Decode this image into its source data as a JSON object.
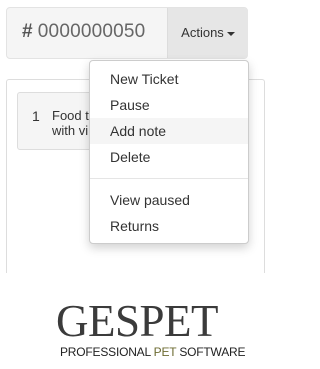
{
  "ticket": {
    "hash": "#",
    "number": "0000000050"
  },
  "actions": {
    "label": "Actions"
  },
  "menu": {
    "items": [
      {
        "label": "New Ticket"
      },
      {
        "label": "Pause"
      },
      {
        "label": "Add note"
      },
      {
        "label": "Delete"
      }
    ],
    "secondary_items": [
      {
        "label": "View paused"
      },
      {
        "label": "Returns"
      }
    ]
  },
  "list": {
    "item": {
      "number": "1",
      "line1": "Food t",
      "line2": "with vi"
    }
  },
  "logo": {
    "part1": "GES",
    "part2": "PET",
    "tag_part1": "PROFESSIONAL ",
    "tag_part2": "PET",
    "tag_part3": " SOFTWARE",
    "brand_color": "#6d6b32"
  }
}
